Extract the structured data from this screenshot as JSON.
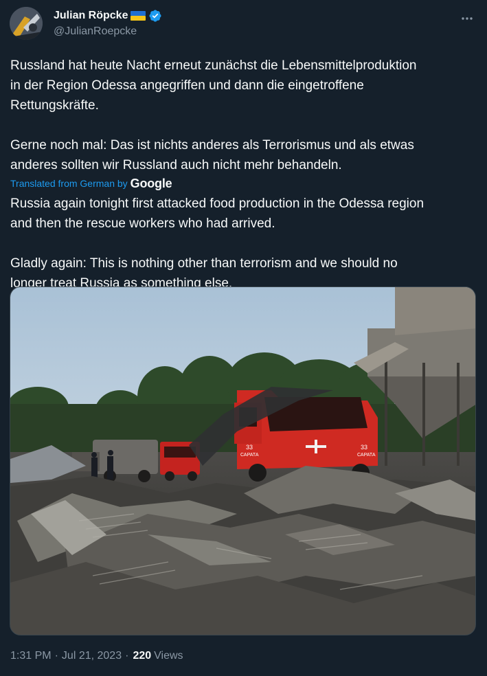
{
  "author": {
    "display_name": "Julian Röpcke",
    "handle": "@JulianRoepcke",
    "avatar_icon": "avatar-photo",
    "flag_icon": "ukraine-flag-icon",
    "verified_icon": "verified-badge-icon",
    "verified_color": "#1d9bf0"
  },
  "more_icon": "more-options-icon",
  "tweet": {
    "original_text": "Russland hat heute Nacht erneut zunächst die Lebensmittelproduktion\nin der Region Odessa angegriffen und dann die eingetroffene\nRettungskräfte.\n\nGerne noch mal: Das ist nichts anderes als Terrorismus und als etwas\nanderes sollten wir Russland auch nicht mehr behandeln.",
    "translated_label": "Translated from German by",
    "translation_provider": "Google",
    "translated_text": "Russia again tonight first attacked food production in the Odessa region\nand then the rescue workers who had arrived.\n\nGladly again: This is nothing other than terrorism and we should no\nlonger treat Russia as something else."
  },
  "media": {
    "truck_label_1": "33",
    "truck_label_2": "САРАТА",
    "truck_label_3": "33",
    "truck_label_4": "САРАТА"
  },
  "meta": {
    "time": "1:31 PM",
    "separator": "·",
    "date": "Jul 21, 2023",
    "views_count": "220",
    "views_label": "Views"
  },
  "colors": {
    "background": "#15202b",
    "text_primary": "#f7f9f9",
    "text_secondary": "#8b98a5",
    "link": "#1d9bf0",
    "border": "#38444d"
  }
}
